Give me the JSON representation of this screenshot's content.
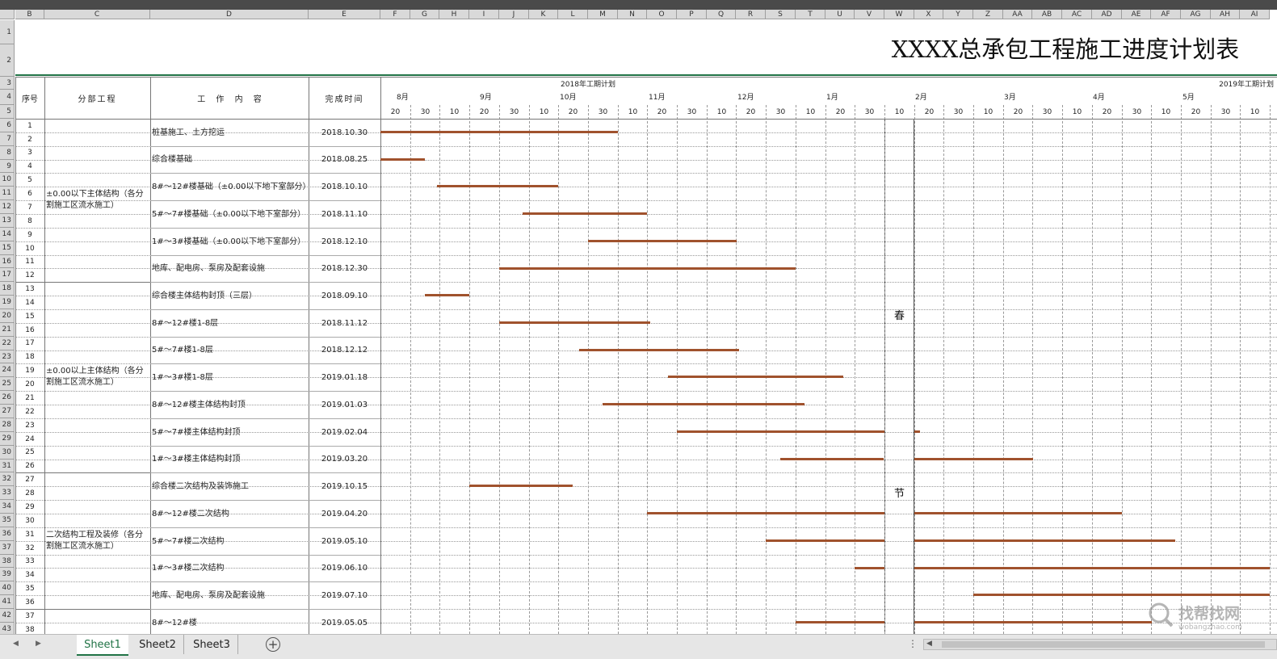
{
  "title": "XXXX总承包工程施工进度计划表",
  "columns": [
    "B",
    "C",
    "D",
    "E",
    "F",
    "G",
    "H",
    "I",
    "J",
    "K",
    "L",
    "M",
    "N",
    "O",
    "P",
    "Q",
    "R",
    "S",
    "T",
    "U",
    "V",
    "W",
    "X",
    "Y",
    "Z",
    "AA",
    "AB",
    "AC",
    "AD",
    "AE",
    "AF",
    "AG",
    "AH",
    "AI"
  ],
  "headers": {
    "seq": "序号",
    "division": "分部工程",
    "work": "工 作 内 容",
    "finish": "完成时间",
    "plan2018": "2018年工期计划",
    "plan2019": "2019年工期计划"
  },
  "months": [
    "8月",
    "9月",
    "10月",
    "11月",
    "12月",
    "1月",
    "2月",
    "3月",
    "4月",
    "5月"
  ],
  "days": [
    "20",
    "30",
    "10",
    "20",
    "30",
    "10",
    "20",
    "30",
    "10",
    "20",
    "30",
    "10",
    "20",
    "30",
    "10",
    "20",
    "30",
    "10",
    "20",
    "30",
    "10",
    "20",
    "30",
    "10",
    "20",
    "30",
    "10",
    "20",
    "30",
    "10",
    "20",
    "30",
    "10"
  ],
  "holiday_text": [
    "春",
    "节"
  ],
  "groups": [
    {
      "name": "±0.00以下主体结构（各分割施工区流水施工）",
      "start": 0,
      "count": 6
    },
    {
      "name": "±0.00以上主体结构（各分割施工区流水施工）",
      "start": 6,
      "count": 7
    },
    {
      "name": "二次结构工程及装修（各分割施工区流水施工）",
      "start": 13,
      "count": 5
    },
    {
      "name": "",
      "start": 18,
      "count": 1
    }
  ],
  "tasks": [
    {
      "a": "1",
      "b": "2",
      "work": "桩基施工、土方挖运",
      "finish": "2018.10.30",
      "bars": [
        [
          0,
          8
        ]
      ]
    },
    {
      "a": "3",
      "b": "4",
      "work": "综合楼基础",
      "finish": "2018.08.25",
      "bars": [
        [
          0,
          1.5
        ]
      ]
    },
    {
      "a": "5",
      "b": "6",
      "work": "8#～12#楼基础（±0.00以下地下室部分）",
      "finish": "2018.10.10",
      "bars": [
        [
          1.9,
          6
        ]
      ]
    },
    {
      "a": "7",
      "b": "8",
      "work": "5#～7#楼基础（±0.00以下地下室部分）",
      "finish": "2018.11.10",
      "bars": [
        [
          4.8,
          9
        ]
      ]
    },
    {
      "a": "9",
      "b": "10",
      "work": "1#～3#楼基础（±0.00以下地下室部分）",
      "finish": "2018.12.10",
      "bars": [
        [
          7,
          12
        ]
      ]
    },
    {
      "a": "11",
      "b": "12",
      "work": "地库、配电房、泵房及配套设施",
      "finish": "2018.12.30",
      "bars": [
        [
          4,
          14
        ]
      ]
    },
    {
      "a": "13",
      "b": "14",
      "work": "综合楼主体结构封顶（三层）",
      "finish": "2018.09.10",
      "bars": [
        [
          1.5,
          3
        ]
      ]
    },
    {
      "a": "15",
      "b": "16",
      "work": "8#～12#楼1-8层",
      "finish": "2018.11.12",
      "bars": [
        [
          4,
          9.1
        ]
      ]
    },
    {
      "a": "17",
      "b": "18",
      "work": "5#～7#楼1-8层",
      "finish": "2018.12.12",
      "bars": [
        [
          6.7,
          12.1
        ]
      ]
    },
    {
      "a": "19",
      "b": "20",
      "work": "1#～3#楼1-8层",
      "finish": "2019.01.18",
      "bars": [
        [
          9.7,
          15.6
        ]
      ]
    },
    {
      "a": "21",
      "b": "22",
      "work": "8#～12#楼主体结构封顶",
      "finish": "2019.01.03",
      "bars": [
        [
          7.5,
          14.3
        ]
      ]
    },
    {
      "a": "23",
      "b": "24",
      "work": "5#～7#楼主体结构封顶",
      "finish": "2019.02.04",
      "bars": [
        [
          10,
          17
        ],
        [
          18,
          18.2
        ]
      ]
    },
    {
      "a": "25",
      "b": "26",
      "work": "1#～3#楼主体结构封顶",
      "finish": "2019.03.20",
      "bars": [
        [
          13.5,
          17
        ],
        [
          18,
          22
        ]
      ]
    },
    {
      "a": "27",
      "b": "28",
      "work": "综合楼二次结构及装饰施工",
      "finish": "2019.10.15",
      "bars": [
        [
          3,
          6.5
        ]
      ]
    },
    {
      "a": "29",
      "b": "30",
      "work": "8#～12#楼二次结构",
      "finish": "2019.04.20",
      "bars": [
        [
          9,
          17
        ],
        [
          18,
          25
        ]
      ]
    },
    {
      "a": "31",
      "b": "32",
      "work": "5#～7#楼二次结构",
      "finish": "2019.05.10",
      "bars": [
        [
          13,
          17
        ],
        [
          18,
          26.8
        ]
      ]
    },
    {
      "a": "33",
      "b": "34",
      "work": "1#～3#楼二次结构",
      "finish": "2019.06.10",
      "bars": [
        [
          16,
          17
        ],
        [
          18,
          30
        ]
      ]
    },
    {
      "a": "35",
      "b": "36",
      "work": "地库、配电房、泵房及配套设施",
      "finish": "2019.07.10",
      "bars": [
        [
          20,
          30
        ]
      ]
    },
    {
      "a": "37",
      "b": "38",
      "work": "8#～12#楼",
      "finish": "2019.05.05",
      "bars": [
        [
          14,
          17
        ],
        [
          18,
          26
        ]
      ]
    }
  ],
  "sheet_tabs": [
    "Sheet1",
    "Sheet2",
    "Sheet3"
  ],
  "active_tab": "Sheet1",
  "colors": {
    "bar": "#a0522d",
    "active_tab": "#217346",
    "header_bg": "#d9d9d9"
  }
}
